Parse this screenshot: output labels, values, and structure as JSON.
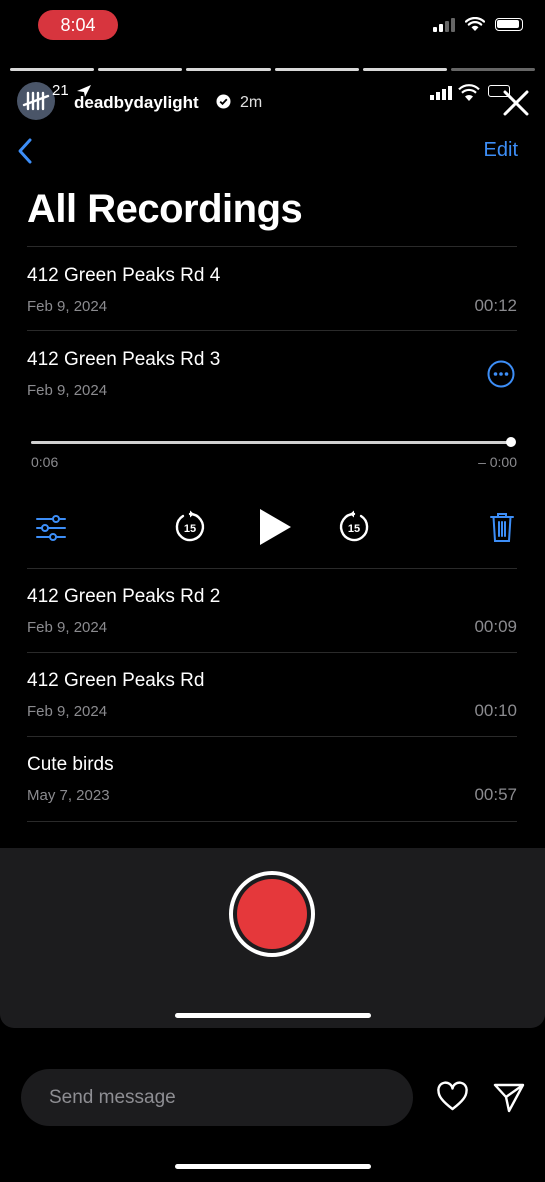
{
  "status_bar": {
    "time": "8:04"
  },
  "story": {
    "avatar_count": "21",
    "username": "deadbydaylight",
    "time_ago": "2m",
    "progress_segments": 6,
    "progress_filled": 5
  },
  "nav": {
    "edit_label": "Edit"
  },
  "page_title": "All Recordings",
  "recordings": [
    {
      "name": "412 Green Peaks Rd 4",
      "date": "Feb 9, 2024",
      "duration": "00:12"
    },
    {
      "name": "412 Green Peaks Rd 3",
      "date": "Feb 9, 2024",
      "duration": ""
    },
    {
      "name": "412 Green Peaks Rd 2",
      "date": "Feb 9, 2024",
      "duration": "00:09"
    },
    {
      "name": "412 Green Peaks Rd",
      "date": "Feb 9, 2024",
      "duration": "00:10"
    },
    {
      "name": "Cute birds",
      "date": "May 7, 2023",
      "duration": "00:57"
    }
  ],
  "player": {
    "elapsed": "0:06",
    "remaining": "– 0:00",
    "skip_back_label": "15",
    "skip_forward_label": "15",
    "progress": 1.0
  },
  "reply": {
    "placeholder": "Send message"
  },
  "colors": {
    "accent": "#3d8ef7",
    "record_red": "#e5383b",
    "time_pill": "#d7353e",
    "secondary_text": "#8b8b8f"
  }
}
